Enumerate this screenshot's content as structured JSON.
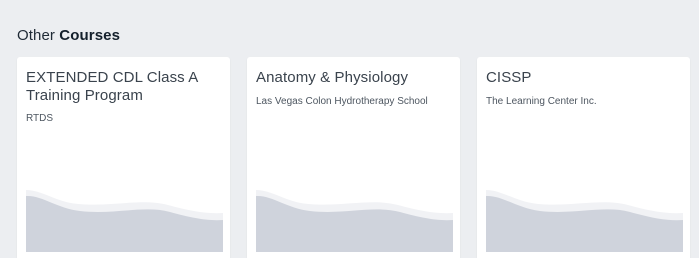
{
  "section": {
    "title_prefix": "Other",
    "title_strong": "Courses"
  },
  "courses": [
    {
      "title": "EXTENDED CDL Class A Training Program",
      "school": "RTDS"
    },
    {
      "title": "Anatomy & Physiology",
      "school": "Las Vegas Colon Hydrotherapy School"
    },
    {
      "title": "CISSP",
      "school": "The Learning Center Inc."
    }
  ],
  "colors": {
    "page_background": "#eceef1",
    "card_background": "#ffffff",
    "wave_fill": "#cfd3dc",
    "wave_highlight": "#f1f2f5"
  },
  "icons": {
    "card_illustration": "wave-placeholder-icon"
  }
}
